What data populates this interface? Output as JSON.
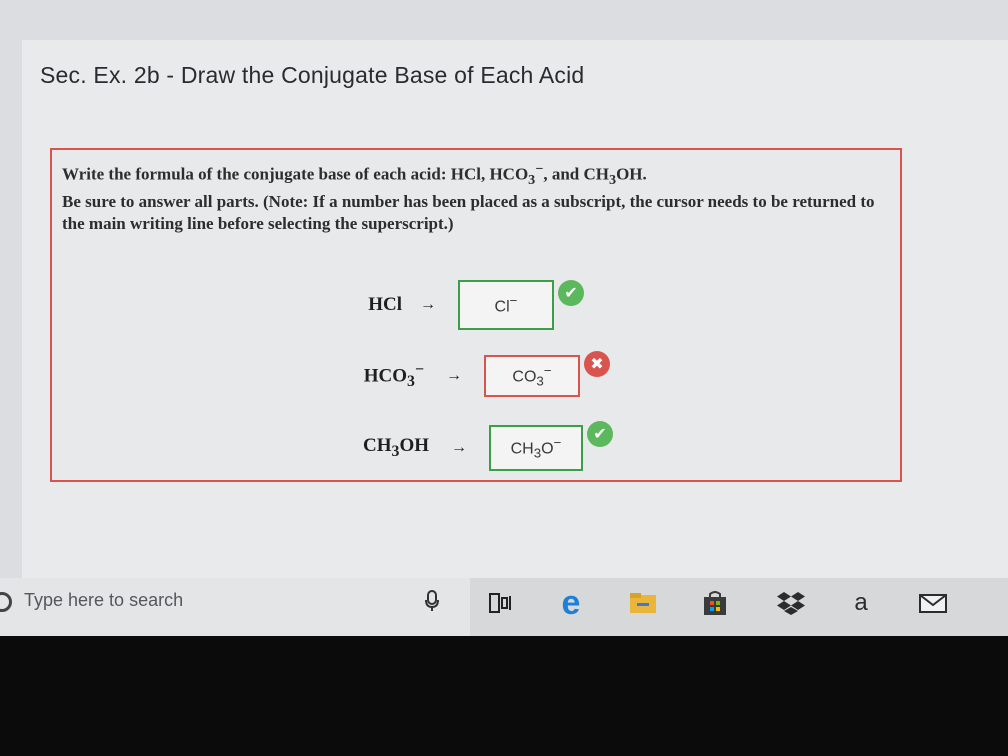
{
  "title": "Sec. Ex. 2b - Draw the Conjugate Base of Each Acid",
  "instructions": {
    "line1_pre": "Write the formula of the conjugate base of each acid: HCl, HCO",
    "line1_sub1": "3",
    "line1_sup": "−",
    "line1_mid": ", and CH",
    "line1_sub2": "3",
    "line1_post": "OH.",
    "line2": "Be sure to answer all parts. (Note: If a number has been placed as a subscript, the cursor needs to be returned to the main writing line before selecting the superscript.)"
  },
  "rows": [
    {
      "acid_main": "HCl",
      "acid_sub": "",
      "acid_post": "",
      "acid_sup": "",
      "arrow": "→",
      "answer_main": "Cl",
      "answer_sub": "",
      "answer_post": "",
      "answer_sup": "−",
      "status": "correct",
      "status_icon": "✔"
    },
    {
      "acid_main": "HCO",
      "acid_sub": "3",
      "acid_post": "",
      "acid_sup": "−",
      "arrow": "→",
      "answer_main": "CO",
      "answer_sub": "3",
      "answer_post": "",
      "answer_sup": "−",
      "status": "incorrect",
      "status_icon": "✖"
    },
    {
      "acid_main": "CH",
      "acid_sub": "3",
      "acid_post": "OH",
      "acid_sup": "",
      "arrow": "→",
      "answer_main": "CH",
      "answer_sub": "3",
      "answer_post": "O",
      "answer_sup": "−",
      "status": "correct",
      "status_icon": "✔"
    }
  ],
  "taskbar": {
    "search_placeholder": "Type here to search",
    "icons": [
      "microphone-icon",
      "task-view-icon",
      "edge-icon",
      "file-explorer-icon",
      "store-icon",
      "dropbox-icon",
      "amazon-icon",
      "mail-icon"
    ],
    "amazon_letter": "a",
    "edge_letter": "e"
  },
  "colors": {
    "correct": "#5cb85c",
    "incorrect": "#d9534f",
    "edge": "#1e7fd6",
    "folder": "#e9b53b"
  }
}
